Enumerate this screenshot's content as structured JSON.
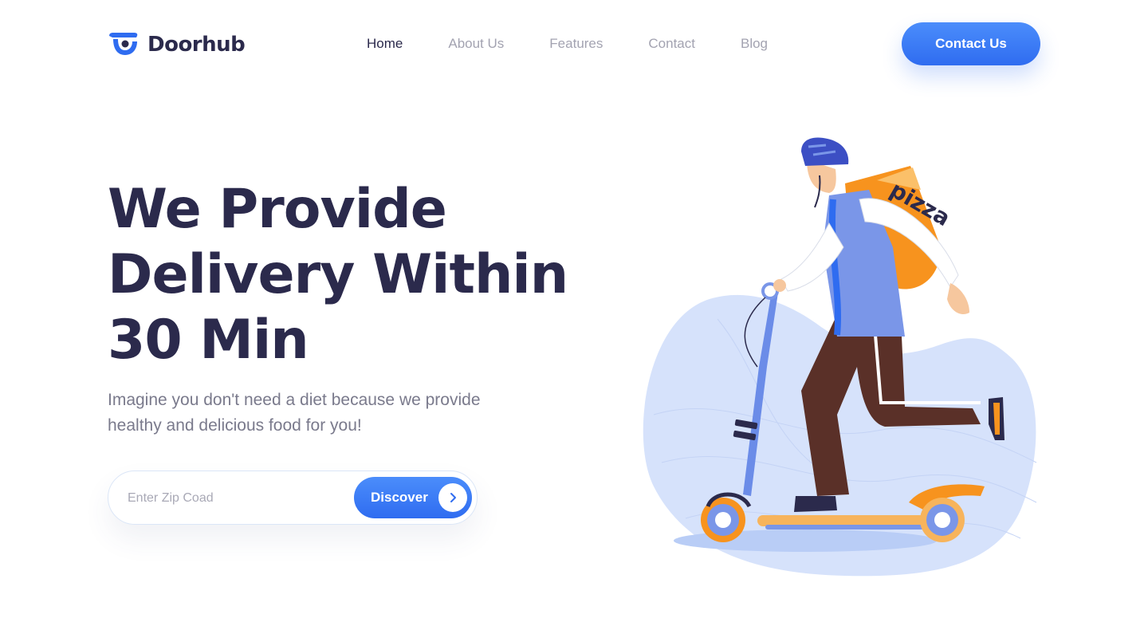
{
  "brand": {
    "name": "Doorhub",
    "logo_icon": "courier-cap-icon",
    "accent": "#2f6cf0"
  },
  "nav": {
    "items": [
      {
        "label": "Home",
        "active": true
      },
      {
        "label": "About Us",
        "active": false
      },
      {
        "label": "Features",
        "active": false
      },
      {
        "label": "Contact",
        "active": false
      },
      {
        "label": "Blog",
        "active": false
      }
    ]
  },
  "header": {
    "cta_label": "Contact Us"
  },
  "hero": {
    "title_lines": [
      "We Provide",
      "Delivery Within",
      "30 Min"
    ],
    "subtitle": "Imagine you don't need a diet because we provide healthy and delicious food for you!",
    "search": {
      "placeholder": "Enter Zip Coad",
      "value": "",
      "button_label": "Discover",
      "button_icon": "chevron-right-icon"
    }
  },
  "illustration": {
    "subject": "delivery-person-on-scooter-illustration",
    "bag_text": "pizza"
  },
  "colors": {
    "text_dark": "#2b2a4c",
    "text_muted": "#a3a3b1",
    "button_blue": "#2f6cf0",
    "blob": "#d6e2fb",
    "bag_orange": "#f7931e"
  }
}
